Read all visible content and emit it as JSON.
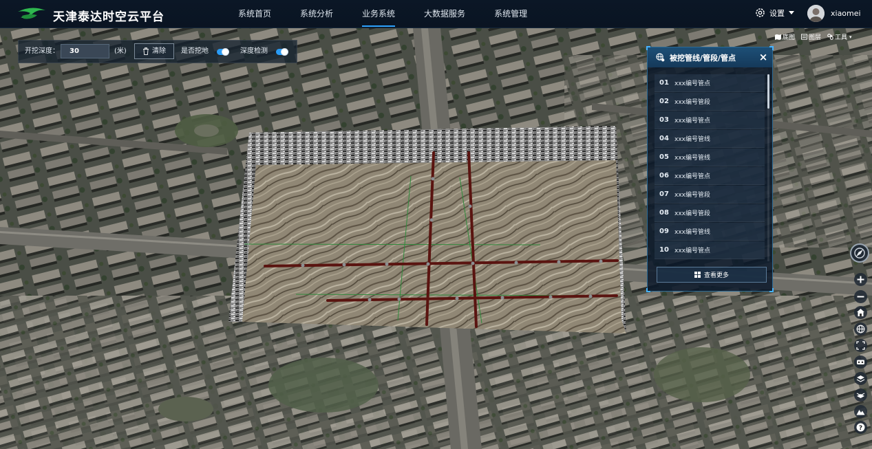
{
  "header": {
    "app_title": "天津泰达时空云平台",
    "nav": [
      {
        "label": "系统首页",
        "active": false
      },
      {
        "label": "系统分析",
        "active": false
      },
      {
        "label": "业务系统",
        "active": true
      },
      {
        "label": "大数据服务",
        "active": false
      },
      {
        "label": "系统管理",
        "active": false
      }
    ],
    "settings_label": "设置",
    "username": "xiaomei"
  },
  "dig_toolbar": {
    "depth_label": "开挖深度：",
    "depth_value": "30",
    "depth_unit": "(米)",
    "clear_label": "清除",
    "dig_toggle_label": "是否挖地",
    "dig_toggle_on": true,
    "detect_toggle_label": "深度检测",
    "detect_toggle_on": true
  },
  "map_tools": [
    {
      "label": "底图",
      "icon": "map-icon"
    },
    {
      "label": "图层",
      "icon": "layers-icon"
    },
    {
      "label": "工具",
      "icon": "tools-icon"
    }
  ],
  "panel": {
    "title": "被挖管线/管段/管点",
    "close_symbol": "×",
    "items": [
      {
        "num": "01",
        "label": "xxx编号管点"
      },
      {
        "num": "02",
        "label": "xxx编号管段"
      },
      {
        "num": "03",
        "label": "xxx编号管点"
      },
      {
        "num": "04",
        "label": "xxx编号管线"
      },
      {
        "num": "05",
        "label": "xxx编号管线"
      },
      {
        "num": "06",
        "label": "xxx编号管点"
      },
      {
        "num": "07",
        "label": "xxx编号管段"
      },
      {
        "num": "08",
        "label": "xxx编号管段"
      },
      {
        "num": "09",
        "label": "xxx编号管线"
      },
      {
        "num": "10",
        "label": "xxx编号管点"
      }
    ],
    "more_label": "查看更多"
  },
  "right_toolbar": [
    "compass-icon",
    "zoom-in-icon",
    "zoom-out-icon",
    "home-icon",
    "globe-icon",
    "fullscreen-icon",
    "vr-icon",
    "layer-up-icon",
    "layer-down-icon",
    "terrain-icon",
    "help-icon"
  ],
  "colors": {
    "accent": "#2a9cf5",
    "topbar": "#0b1726",
    "pipe": "#5a1410"
  }
}
